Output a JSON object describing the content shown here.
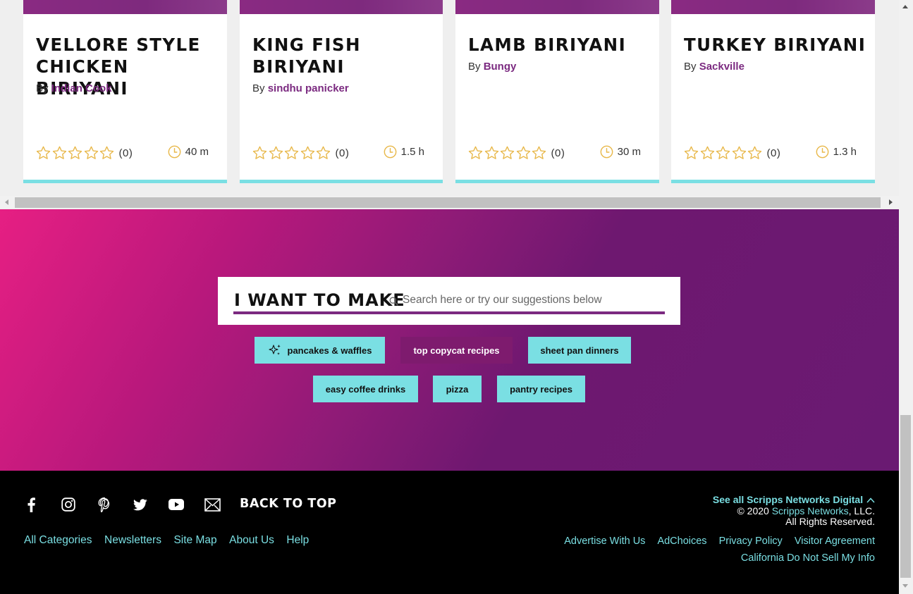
{
  "cards": [
    {
      "title": "Vellore Style Chicken Biriyani",
      "by_label": "By",
      "author": "Indian Cook",
      "rating_count": "(0)",
      "time": "40 m"
    },
    {
      "title": "King Fish Biriyani",
      "by_label": "By",
      "author": "sindhu panicker",
      "rating_count": "(0)",
      "time": "1.5 h"
    },
    {
      "title": "Lamb Biriyani",
      "by_label": "By",
      "author": "Bungy",
      "rating_count": "(0)",
      "time": "30 m"
    },
    {
      "title": "Turkey Biriyani",
      "by_label": "By",
      "author": "Sackville",
      "rating_count": "(0)",
      "time": "1.3 h"
    }
  ],
  "make": {
    "label": "I WANT TO MAKE",
    "placeholder": "Search here or try our suggestions below",
    "suggestions": [
      {
        "label": "pancakes & waffles",
        "icon": "sparkle-icon"
      },
      {
        "label": "top copycat recipes",
        "active": true
      },
      {
        "label": "sheet pan dinners"
      },
      {
        "label": "easy coffee drinks"
      },
      {
        "label": "pizza"
      },
      {
        "label": "pantry recipes"
      }
    ]
  },
  "footer": {
    "social_icons": [
      "facebook-icon",
      "instagram-icon",
      "pinterest-icon",
      "twitter-icon",
      "youtube-icon",
      "email-icon"
    ],
    "back_to_top": "BACK TO TOP",
    "links": [
      "All Categories",
      "Newsletters",
      "Site Map",
      "About Us",
      "Help"
    ],
    "see_all": "See all Scripps Networks Digital",
    "copyright_prefix": "© 2020",
    "company": "Scripps Networks",
    "copyright_suffix": ", LLC.",
    "rights": "All Rights Reserved.",
    "legal_links": [
      "Advertise With Us",
      "AdChoices",
      "Privacy Policy",
      "Visitor Agreement"
    ],
    "ccpa_link": "California Do Not Sell My Info"
  },
  "colors": {
    "accent_purple": "#7b2a80",
    "teal": "#7adfe3",
    "star": "#e8b84a"
  }
}
